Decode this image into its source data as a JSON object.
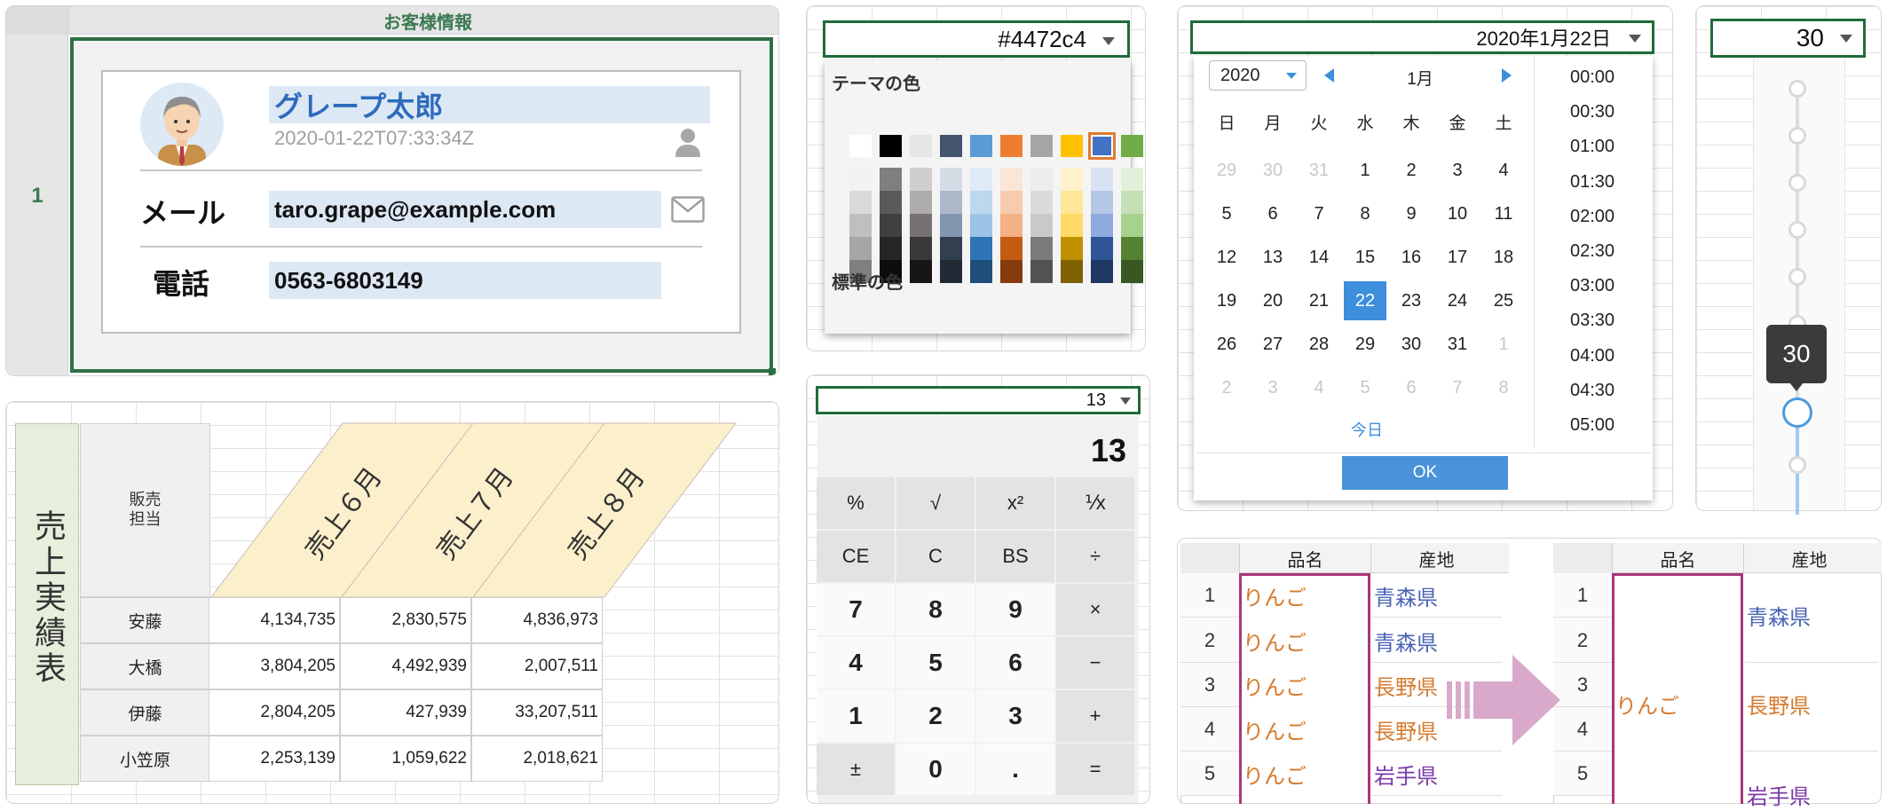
{
  "customer": {
    "title": "お客様情報",
    "row_number": "1",
    "name": "グレープ太郎",
    "timestamp": "2020-01-22T07:33:34Z",
    "mail_label": "メール",
    "email": "taro.grape@example.com",
    "phone_label": "電話",
    "phone": "0563-6803149"
  },
  "color_picker": {
    "value": "#4472c4",
    "theme_label": "テーマの色",
    "standard_label": "標準の色",
    "theme_top": [
      "#ffffff",
      "#000000",
      "#e7e6e6",
      "#44546a",
      "#5b9bd5",
      "#ed7d31",
      "#a5a5a5",
      "#ffc000",
      "#4472c4",
      "#70ad47"
    ],
    "theme_shades": [
      [
        "#f2f2f2",
        "#7f7f7f",
        "#d0cece",
        "#d6dce5",
        "#deebf7",
        "#fbe5d6",
        "#ededed",
        "#fff2cc",
        "#dae3f3",
        "#e2f0d9"
      ],
      [
        "#d9d9d9",
        "#595959",
        "#aeabab",
        "#adb9ca",
        "#bdd7ee",
        "#f8cbad",
        "#dbdbdb",
        "#ffe699",
        "#b4c7e7",
        "#c5e0b4"
      ],
      [
        "#bfbfbf",
        "#404040",
        "#767171",
        "#8497b0",
        "#9dc3e6",
        "#f4b183",
        "#c9c9c9",
        "#ffd966",
        "#8faadc",
        "#a9d18e"
      ],
      [
        "#a6a6a6",
        "#262626",
        "#3b3838",
        "#323f4f",
        "#2e75b6",
        "#c55a11",
        "#7b7b7b",
        "#bf9000",
        "#2f5597",
        "#548235"
      ],
      [
        "#7f7f7f",
        "#0d0d0d",
        "#171515",
        "#222a35",
        "#1f4e79",
        "#843c0c",
        "#525252",
        "#7f6000",
        "#203864",
        "#385723"
      ]
    ],
    "standard": [
      "#c00000",
      "#ff0000",
      "#ffc000",
      "#ffff00",
      "#92d050",
      "#00b050",
      "#00b0f0",
      "#0070c0",
      "#002060",
      "#7030a0"
    ],
    "selected_index": 8
  },
  "date_picker": {
    "value": "2020年1月22日",
    "year": "2020",
    "month": "1月",
    "weekdays": [
      "日",
      "月",
      "火",
      "水",
      "木",
      "金",
      "土"
    ],
    "weeks": [
      [
        [
          "29",
          1
        ],
        [
          "30",
          1
        ],
        [
          "31",
          1
        ],
        [
          "1",
          0
        ],
        [
          "2",
          0
        ],
        [
          "3",
          0
        ],
        [
          "4",
          0
        ]
      ],
      [
        [
          "5",
          0
        ],
        [
          "6",
          0
        ],
        [
          "7",
          0
        ],
        [
          "8",
          0
        ],
        [
          "9",
          0
        ],
        [
          "10",
          0
        ],
        [
          "11",
          0
        ]
      ],
      [
        [
          "12",
          0
        ],
        [
          "13",
          0
        ],
        [
          "14",
          0
        ],
        [
          "15",
          0
        ],
        [
          "16",
          0
        ],
        [
          "17",
          0
        ],
        [
          "18",
          0
        ]
      ],
      [
        [
          "19",
          0
        ],
        [
          "20",
          0
        ],
        [
          "21",
          0
        ],
        [
          "22",
          0
        ],
        [
          "23",
          0
        ],
        [
          "24",
          0
        ],
        [
          "25",
          0
        ]
      ],
      [
        [
          "26",
          0
        ],
        [
          "27",
          0
        ],
        [
          "28",
          0
        ],
        [
          "29",
          0
        ],
        [
          "30",
          0
        ],
        [
          "31",
          0
        ],
        [
          "1",
          1
        ]
      ],
      [
        [
          "2",
          1
        ],
        [
          "3",
          1
        ],
        [
          "4",
          1
        ],
        [
          "5",
          1
        ],
        [
          "6",
          1
        ],
        [
          "7",
          1
        ],
        [
          "8",
          1
        ]
      ]
    ],
    "selected_day": "22",
    "today_label": "今日",
    "ok_label": "OK",
    "times": [
      "00:00",
      "00:30",
      "01:00",
      "01:30",
      "02:00",
      "02:30",
      "03:00",
      "03:30",
      "04:00",
      "04:30",
      "05:00"
    ]
  },
  "slider": {
    "value": "30",
    "tooltip": "30",
    "level_fraction": 0.7
  },
  "sales": {
    "title": "売上実績表",
    "header_rep": "販売\n担当",
    "months": [
      "売上６月",
      "売上７月",
      "売上８月"
    ],
    "rows": [
      {
        "name": "安藤",
        "values": [
          "4,134,735",
          "2,830,575",
          "4,836,973"
        ]
      },
      {
        "name": "大橋",
        "values": [
          "3,804,205",
          "4,492,939",
          "2,007,511"
        ]
      },
      {
        "name": "伊藤",
        "values": [
          "2,804,205",
          "427,939",
          "33,207,511"
        ]
      },
      {
        "name": "小笠原",
        "values": [
          "2,253,139",
          "1,059,622",
          "2,018,621"
        ]
      }
    ]
  },
  "calculator": {
    "value": "13",
    "display": "13",
    "keys": [
      [
        "%",
        "√",
        "x²",
        "⅟x"
      ],
      [
        "CE",
        "C",
        "BS",
        "÷"
      ],
      [
        "7",
        "8",
        "9",
        "×"
      ],
      [
        "4",
        "5",
        "6",
        "−"
      ],
      [
        "1",
        "2",
        "3",
        "+"
      ],
      [
        "±",
        "0",
        ".",
        "="
      ]
    ]
  },
  "merge_table": {
    "col_name": "品名",
    "col_origin": "産地",
    "rows": [
      "1",
      "2",
      "3",
      "4",
      "5"
    ],
    "before": [
      {
        "name": "りんご",
        "origin": "青森県",
        "color": "#4a64b5"
      },
      {
        "name": "りんご",
        "origin": "青森県",
        "color": "#4a64b5"
      },
      {
        "name": "りんご",
        "origin": "長野県",
        "color": "#d67b2e"
      },
      {
        "name": "りんご",
        "origin": "長野県",
        "color": "#d67b2e"
      },
      {
        "name": "りんご",
        "origin": "岩手県",
        "color": "#7a3aa8"
      }
    ],
    "after_name": "りんご",
    "after_origins": [
      "青森県",
      "長野県",
      "岩手県"
    ]
  }
}
